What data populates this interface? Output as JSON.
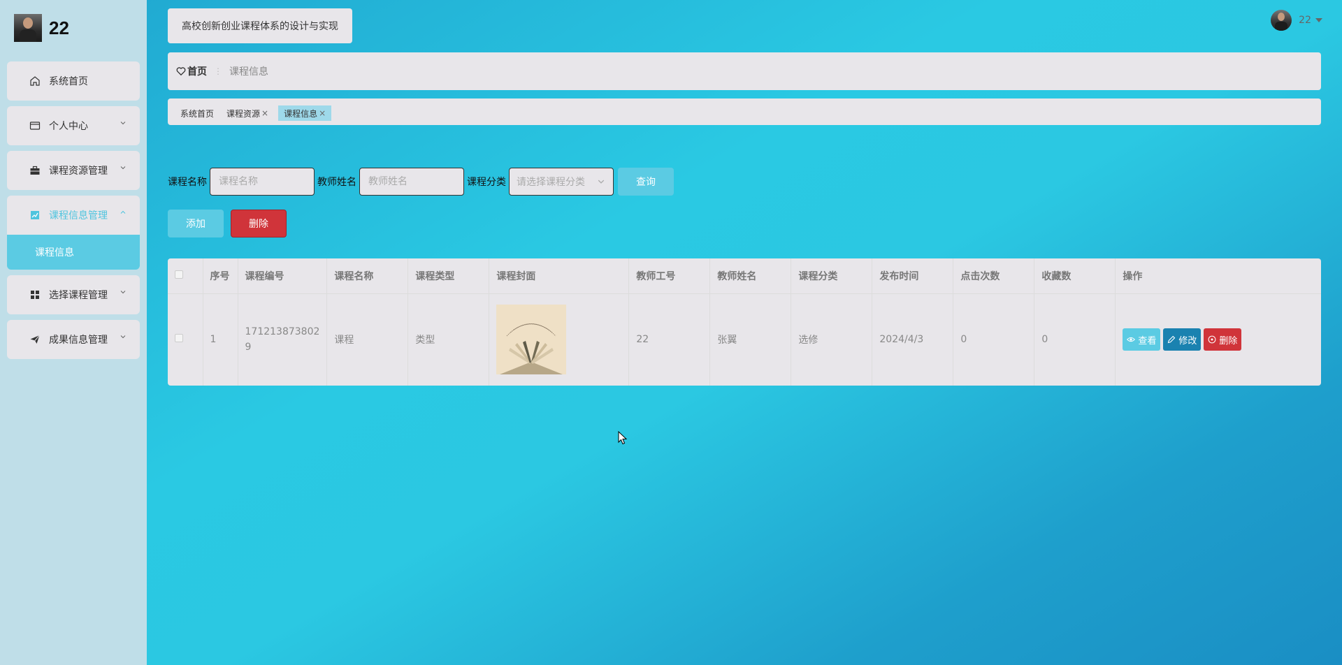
{
  "brand": {
    "name": "22"
  },
  "app_title": "高校创新创业课程体系的设计与实现",
  "user": {
    "name": "22"
  },
  "sidebar": {
    "items": [
      {
        "label": "系统首页",
        "icon": "home-icon"
      },
      {
        "label": "个人中心",
        "icon": "id-card-icon"
      },
      {
        "label": "课程资源管理",
        "icon": "briefcase-icon"
      },
      {
        "label": "课程信息管理",
        "icon": "chart-icon",
        "active": true,
        "sub": [
          {
            "label": "课程信息"
          }
        ]
      },
      {
        "label": "选择课程管理",
        "icon": "grid-icon"
      },
      {
        "label": "成果信息管理",
        "icon": "send-icon"
      }
    ]
  },
  "breadcrumb": {
    "home": "首页",
    "current": "课程信息"
  },
  "tags": [
    {
      "label": "系统首页"
    },
    {
      "label": "课程资源"
    },
    {
      "label": "课程信息"
    }
  ],
  "search": {
    "course_name_label": "课程名称",
    "course_name_placeholder": "课程名称",
    "teacher_name_label": "教师姓名",
    "teacher_name_placeholder": "教师姓名",
    "category_label": "课程分类",
    "category_placeholder": "请选择课程分类",
    "query_button": "查询"
  },
  "actions": {
    "add": "添加",
    "delete": "删除"
  },
  "table": {
    "headers": [
      "序号",
      "课程编号",
      "课程名称",
      "课程类型",
      "课程封面",
      "教师工号",
      "教师姓名",
      "课程分类",
      "发布时间",
      "点击次数",
      "收藏数",
      "操作"
    ],
    "rows": [
      {
        "index": "1",
        "code_line1": "171213873802",
        "code_line2": "9",
        "name": "课程",
        "type": "类型",
        "teacher_id": "22",
        "teacher_name": "张翼",
        "category": "选修",
        "publish_time": "2024/4/3",
        "clicks": "0",
        "favorites": "0",
        "ops": {
          "view": "查看",
          "edit": "修改",
          "delete": "删除"
        }
      }
    ]
  },
  "colors": {
    "accent": "#5bcbe3",
    "danger": "#d0343a",
    "edit": "#1a82b0",
    "sidebar_bg": "#bfdee8",
    "panel_bg": "#e8e6ea"
  }
}
